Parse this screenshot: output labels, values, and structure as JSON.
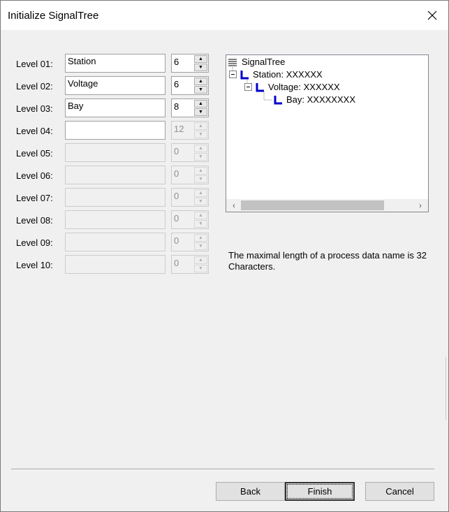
{
  "window": {
    "title": "Initialize SignalTree",
    "close_glyph": "✕"
  },
  "levels": [
    {
      "label": "Level 01:",
      "name": "Station",
      "length": "6",
      "enabled": true
    },
    {
      "label": "Level 02:",
      "name": "Voltage",
      "length": "6",
      "enabled": true
    },
    {
      "label": "Level 03:",
      "name": "Bay",
      "length": "8",
      "enabled": true
    },
    {
      "label": "Level 04:",
      "name": "",
      "length": "12",
      "enabled": "partial"
    },
    {
      "label": "Level 05:",
      "name": "",
      "length": "0",
      "enabled": false
    },
    {
      "label": "Level 06:",
      "name": "",
      "length": "0",
      "enabled": false
    },
    {
      "label": "Level 07:",
      "name": "",
      "length": "0",
      "enabled": false
    },
    {
      "label": "Level 08:",
      "name": "",
      "length": "0",
      "enabled": false
    },
    {
      "label": "Level 09:",
      "name": "",
      "length": "0",
      "enabled": false
    },
    {
      "label": "Level 10:",
      "name": "",
      "length": "0",
      "enabled": false
    }
  ],
  "spin_glyphs": {
    "up": "▲",
    "down": "▼"
  },
  "tree": {
    "root": "SignalTree",
    "nodes": [
      "Station: XXXXXX",
      "Voltage: XXXXXX",
      "Bay: XXXXXXXX"
    ],
    "expander_glyph": "⊟",
    "scroll_left": "‹",
    "scroll_right": "›"
  },
  "info_text": "The maximal length of a process data name is 32 Characters.",
  "buttons": {
    "back": "Back",
    "finish": "Finish",
    "cancel": "Cancel"
  },
  "colors": {
    "node_icon": "#0000cc",
    "window_bg": "#f0f0f0",
    "title_bg": "#ffffff"
  }
}
